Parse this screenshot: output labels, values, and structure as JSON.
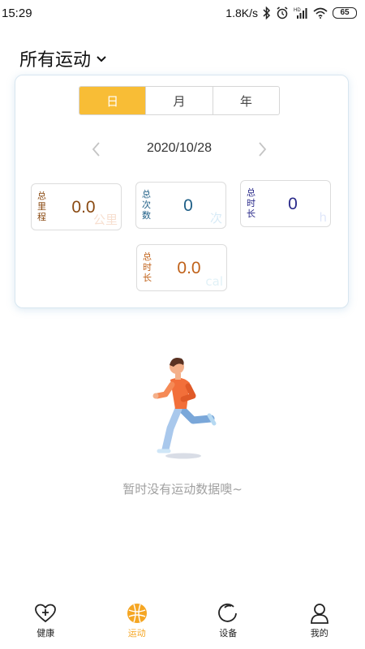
{
  "status_bar": {
    "time": "15:29",
    "network_speed": "1.8K/s",
    "battery": "65",
    "icons": [
      "bluetooth-icon",
      "alarm-icon",
      "hd-signal-icon",
      "wifi-icon",
      "battery-icon"
    ]
  },
  "header": {
    "title": "所有运动",
    "dropdown_icon": "chevron-down-icon"
  },
  "tabs": [
    {
      "label": "日",
      "active": true
    },
    {
      "label": "月",
      "active": false
    },
    {
      "label": "年",
      "active": false
    }
  ],
  "date_nav": {
    "date": "2020/10/28",
    "prev_icon": "chevron-left-icon",
    "next_icon": "chevron-right-icon"
  },
  "stats": {
    "distance": {
      "label": "总里程",
      "value": "0.0",
      "watermark": "公里"
    },
    "count": {
      "label": "总次数",
      "value": "0",
      "watermark": "次"
    },
    "duration": {
      "label": "总时长",
      "value": "0",
      "watermark": "h"
    },
    "calorie": {
      "label": "总时长",
      "value": "0.0",
      "watermark": "cal"
    }
  },
  "empty_state": {
    "illustration": "running-person-illustration",
    "text": "暂时没有运动数据噢~"
  },
  "bottom_nav": [
    {
      "label": "健康",
      "icon": "heart-plus-icon",
      "active": false
    },
    {
      "label": "运动",
      "icon": "sport-ball-icon",
      "active": true
    },
    {
      "label": "设备",
      "icon": "device-ring-icon",
      "active": false
    },
    {
      "label": "我的",
      "icon": "person-icon",
      "active": false
    }
  ],
  "colors": {
    "accent": "#f8bd36",
    "nav_active": "#f5a623",
    "card_border": "#d8e6f0",
    "empty_text": "#a0a0a0"
  }
}
